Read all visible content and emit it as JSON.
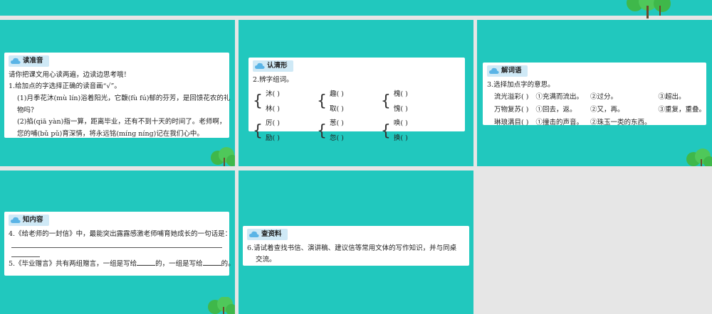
{
  "slides": [
    {
      "tag": "读准音",
      "lines": [
        "请你把课文用心读两遍，边读边思考哦！",
        "1.给加点的字选择正确的读音画“√”。",
        "(1)月季花沐(mù  lín)浴着阳光，它馥(fù  fú)郁的芬芳，是回馈花农的礼",
        "物吗？",
        "(2)掐(qiā  yàn)指一算，距离毕业，还有不到十天的时间了。老师啊，",
        "您的哺(bǔ  pǔ)育深情，将永远铭(míng  níng)记在我们心中。"
      ]
    },
    {
      "tag": "认清形",
      "title": "2.辨字组词。",
      "groups": [
        [
          "沐(        )",
          "林(        )"
        ],
        [
          "趣(        )",
          "取(        )"
        ],
        [
          "槐(        )",
          "愧(        )"
        ],
        [
          "厉(        )",
          "励(        )"
        ],
        [
          "葱(        )",
          "忽(        )"
        ],
        [
          "唤(        )",
          "换(        )"
        ]
      ]
    },
    {
      "tag": "解词语",
      "title": "3.选择加点字的意思。",
      "rows": [
        [
          "流光溢彩(      )",
          "①充满而流出。",
          "②过分。",
          "③超出。"
        ],
        [
          "万物复苏(      )",
          "①回去，返。",
          "②又，再。",
          "③重复，重叠。"
        ],
        [
          "琳琅满目(      )",
          "①撞击的声音。",
          "②珠玉一类的东西。",
          ""
        ]
      ]
    },
    {
      "tag": "知内容",
      "lines": [
        "4.《给老师的一封信》中，最能突出露露感激老师哺育她成长的一句话是：",
        "5.《毕业赠言》共有两组赠言，一组是写给",
        "的，一组是写给",
        "的。"
      ]
    },
    {
      "tag": "查资料",
      "lines": [
        "6.请试着查找书信、演讲稿、建议信等常用文体的写作知识，并与同桌",
        "交流。"
      ]
    }
  ],
  "colors": {
    "slide_bg": "#21c8be",
    "card_bg": "#ffffff",
    "tag_bg": "#cfe9f6",
    "page_bg": "#e6e6e6",
    "tree_green": "#3fb84a"
  },
  "icons": [
    "cloud-icon",
    "tree-icon"
  ]
}
